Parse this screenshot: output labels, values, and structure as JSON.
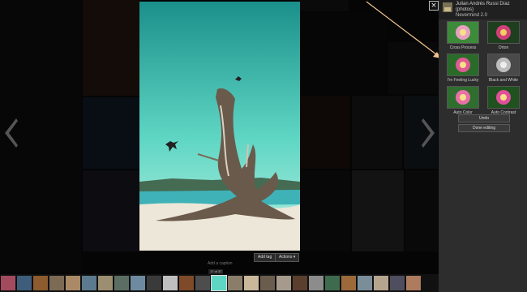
{
  "viewer": {
    "close_icon": "×",
    "prev_icon": "chevron-left-icon",
    "next_icon": "chevron-right-icon",
    "add_tag_label": "Add tag",
    "actions_label": "Actions ▾",
    "caption_placeholder": "Add a caption",
    "counter": "17 of 37"
  },
  "sidebar": {
    "user_name": "Julian Andrés Russi Díaz (photos)",
    "album": "Nevermind 2.0",
    "filters": [
      {
        "label": "Cross Process"
      },
      {
        "label": "Orton"
      },
      {
        "label": "I'm Feeling Lucky"
      },
      {
        "label": "Black and White"
      },
      {
        "label": "Auto Color"
      },
      {
        "label": "Auto Contrast"
      }
    ],
    "undo_label": "Undo",
    "done_label": "Done editing"
  },
  "colors": {
    "accent": "#f0c38f",
    "sky": "#5fd6c4",
    "sand": "#ece7d8"
  }
}
